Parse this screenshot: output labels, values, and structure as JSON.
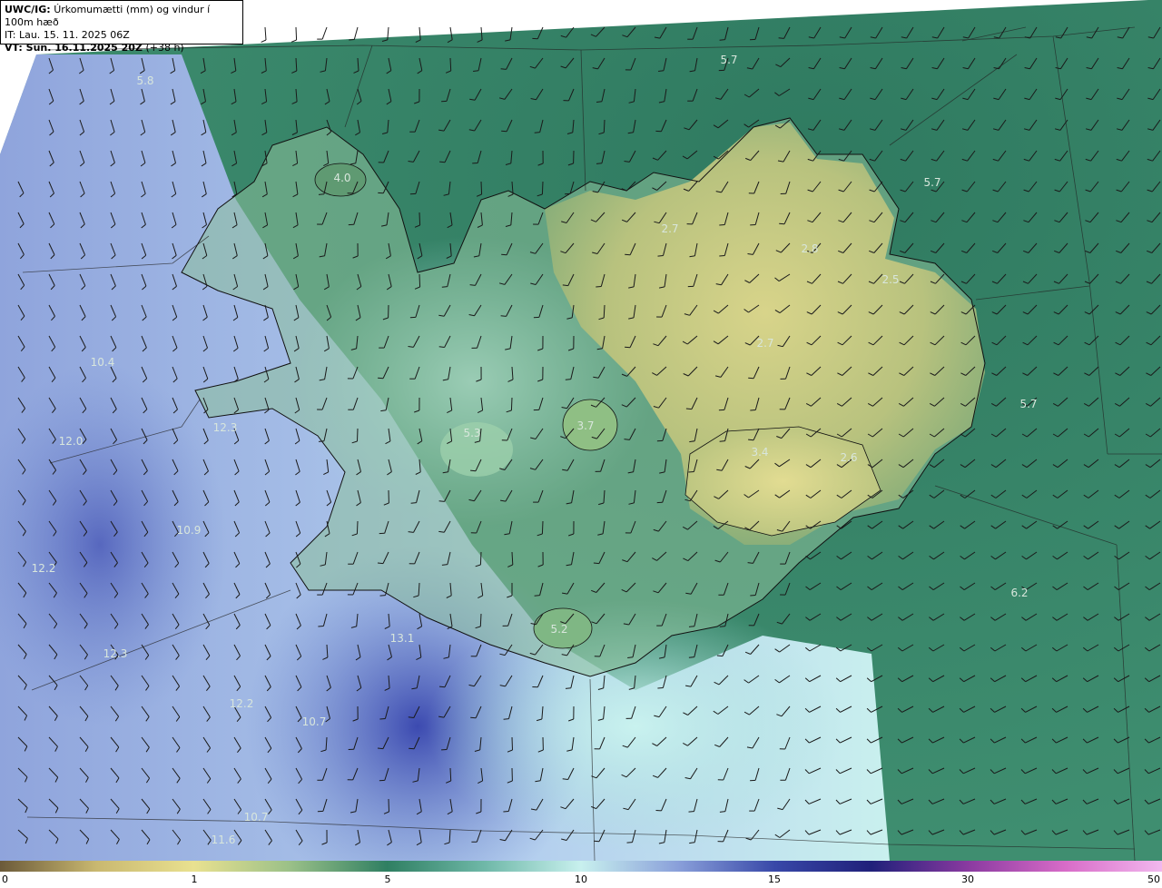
{
  "header": {
    "product": "UWC/IG:",
    "description": "Úrkomumætti (mm) og vindur í 100m hæð",
    "it_line": "IT: Lau. 15. 11. 2025 06Z",
    "vt_prefix": "VT: Sun. 16.11.2025 20Z",
    "vt_suffix": "(+38 h)"
  },
  "colorbar": {
    "ticks": [
      "0",
      "1",
      "5",
      "10",
      "15",
      "30",
      "50"
    ],
    "colors": [
      "#6b5a3a",
      "#c9b870",
      "#e9e190",
      "#9ac088",
      "#2f7f62",
      "#6fb8a8",
      "#c8f0ee",
      "#8aa0da",
      "#3848a8",
      "#20207a",
      "#8a3aa0",
      "#d86cc8",
      "#f2b8ee"
    ]
  },
  "map": {
    "value_labels": [
      {
        "text": "5.7"
      },
      {
        "text": "5.8"
      },
      {
        "text": "4.0"
      },
      {
        "text": "5.7"
      },
      {
        "text": "2.7"
      },
      {
        "text": "2.8"
      },
      {
        "text": "2.5"
      },
      {
        "text": "2.7"
      },
      {
        "text": "5.7"
      },
      {
        "text": "3.7"
      },
      {
        "text": "5.3"
      },
      {
        "text": "3.4"
      },
      {
        "text": "2.6"
      },
      {
        "text": "10.4"
      },
      {
        "text": "12.3"
      },
      {
        "text": "12.0"
      },
      {
        "text": "10.9"
      },
      {
        "text": "12.2"
      },
      {
        "text": "5.2"
      },
      {
        "text": "13.1"
      },
      {
        "text": "12.3"
      },
      {
        "text": "12.2"
      },
      {
        "text": "10.7"
      },
      {
        "text": "6.2"
      },
      {
        "text": "10.7"
      },
      {
        "text": "11.6"
      }
    ]
  }
}
